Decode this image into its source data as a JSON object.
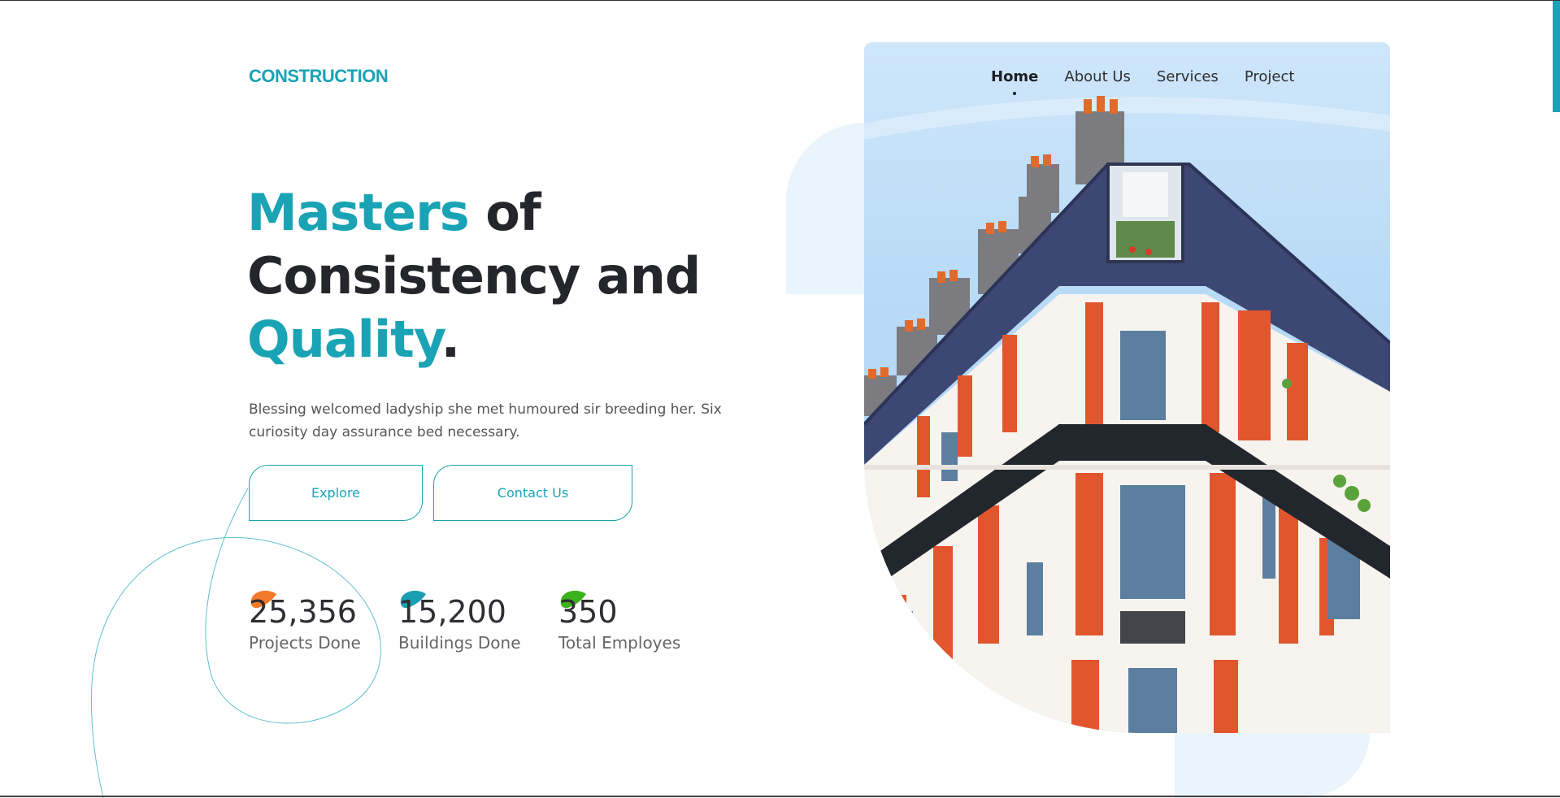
{
  "brand": {
    "logo_text": "CONSTRUCTION",
    "accent_color": "#1aa3b4"
  },
  "nav": {
    "items": [
      {
        "label": "Home",
        "active": true
      },
      {
        "label": "About Us",
        "active": false
      },
      {
        "label": "Services",
        "active": false
      },
      {
        "label": "Project",
        "active": false
      }
    ]
  },
  "hero": {
    "headline_part1": "Masters",
    "headline_part2": " of",
    "headline_part3": "Consistency and",
    "headline_part4": "Quality",
    "headline_part5": ".",
    "description": "Blessing welcomed ladyship she met humoured sir breeding her. Six curiosity day assurance bed necessary.",
    "buttons": {
      "explore": "Explore",
      "contact": "Contact Us"
    }
  },
  "stats": [
    {
      "value": "25,356",
      "label": "Projects Done",
      "icon_color": "#f37a2b"
    },
    {
      "value": "15,200",
      "label": "Buildings Done",
      "icon_color": "#1a9fb2"
    },
    {
      "value": "350",
      "label": "Total Employes",
      "icon_color": "#3cb21c"
    }
  ]
}
